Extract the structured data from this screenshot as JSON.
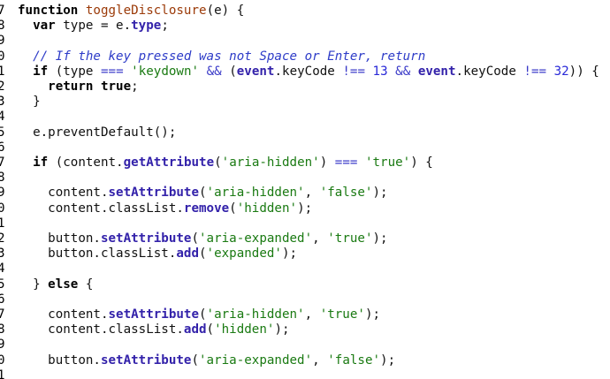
{
  "window": {
    "top_strip_text": ""
  },
  "colors": {
    "background": "#ffffff",
    "keyword": "#000000",
    "function_name": "#9b3a08",
    "property": "#3322aa",
    "string": "#1a7a12",
    "number": "#2a2ad8",
    "comment": "#2e3cc8"
  },
  "lines": [
    {
      "n": "7",
      "tokens": [
        [
          "kw",
          "function"
        ],
        [
          "plain",
          " "
        ],
        [
          "fn",
          "toggleDisclosure"
        ],
        [
          "plain",
          "(e) "
        ],
        [
          "plain",
          "{"
        ]
      ]
    },
    {
      "n": "8",
      "tokens": [
        [
          "plain",
          "  "
        ],
        [
          "kw",
          "var"
        ],
        [
          "plain",
          " type = e."
        ],
        [
          "prop",
          "type"
        ],
        [
          "plain",
          ";"
        ]
      ]
    },
    {
      "n": "9",
      "tokens": []
    },
    {
      "n": "0",
      "tokens": [
        [
          "plain",
          "  "
        ],
        [
          "cmt",
          "// If the key pressed was not Space or Enter, return"
        ]
      ]
    },
    {
      "n": "1",
      "tokens": [
        [
          "plain",
          "  "
        ],
        [
          "kw",
          "if"
        ],
        [
          "plain",
          " (type "
        ],
        [
          "op",
          "==="
        ],
        [
          "plain",
          " "
        ],
        [
          "str",
          "'keydown'"
        ],
        [
          "plain",
          " "
        ],
        [
          "op",
          "&&"
        ],
        [
          "plain",
          " ("
        ],
        [
          "prop",
          "event"
        ],
        [
          "plain",
          ".keyCode "
        ],
        [
          "op",
          "!=="
        ],
        [
          "plain",
          " "
        ],
        [
          "num",
          "13"
        ],
        [
          "plain",
          " "
        ],
        [
          "op",
          "&&"
        ],
        [
          "plain",
          " "
        ],
        [
          "prop",
          "event"
        ],
        [
          "plain",
          ".keyCode "
        ],
        [
          "op",
          "!=="
        ],
        [
          "plain",
          " "
        ],
        [
          "num",
          "32"
        ],
        [
          "plain",
          ")) {"
        ]
      ]
    },
    {
      "n": "2",
      "tokens": [
        [
          "plain",
          "    "
        ],
        [
          "kw",
          "return"
        ],
        [
          "plain",
          " "
        ],
        [
          "kw",
          "true"
        ],
        [
          "plain",
          ";"
        ]
      ]
    },
    {
      "n": "3",
      "tokens": [
        [
          "plain",
          "  }"
        ]
      ]
    },
    {
      "n": "4",
      "tokens": []
    },
    {
      "n": "5",
      "tokens": [
        [
          "plain",
          "  e.preventDefault();"
        ]
      ]
    },
    {
      "n": "6",
      "tokens": []
    },
    {
      "n": "7",
      "tokens": [
        [
          "plain",
          "  "
        ],
        [
          "kw",
          "if"
        ],
        [
          "plain",
          " (content."
        ],
        [
          "prop",
          "getAttribute"
        ],
        [
          "plain",
          "("
        ],
        [
          "str",
          "'aria-hidden'"
        ],
        [
          "plain",
          ") "
        ],
        [
          "op",
          "==="
        ],
        [
          "plain",
          " "
        ],
        [
          "str",
          "'true'"
        ],
        [
          "plain",
          ") {"
        ]
      ]
    },
    {
      "n": "8",
      "tokens": []
    },
    {
      "n": "9",
      "tokens": [
        [
          "plain",
          "    content."
        ],
        [
          "prop",
          "setAttribute"
        ],
        [
          "plain",
          "("
        ],
        [
          "str",
          "'aria-hidden'"
        ],
        [
          "plain",
          ", "
        ],
        [
          "str",
          "'false'"
        ],
        [
          "plain",
          ");"
        ]
      ]
    },
    {
      "n": "0",
      "tokens": [
        [
          "plain",
          "    content.classList."
        ],
        [
          "prop",
          "remove"
        ],
        [
          "plain",
          "("
        ],
        [
          "str",
          "'hidden'"
        ],
        [
          "plain",
          ");"
        ]
      ]
    },
    {
      "n": "1",
      "tokens": []
    },
    {
      "n": "2",
      "tokens": [
        [
          "plain",
          "    button."
        ],
        [
          "prop",
          "setAttribute"
        ],
        [
          "plain",
          "("
        ],
        [
          "str",
          "'aria-expanded'"
        ],
        [
          "plain",
          ", "
        ],
        [
          "str",
          "'true'"
        ],
        [
          "plain",
          ");"
        ]
      ]
    },
    {
      "n": "3",
      "tokens": [
        [
          "plain",
          "    button.classList."
        ],
        [
          "prop",
          "add"
        ],
        [
          "plain",
          "("
        ],
        [
          "str",
          "'expanded'"
        ],
        [
          "plain",
          ");"
        ]
      ]
    },
    {
      "n": "4",
      "tokens": []
    },
    {
      "n": "5",
      "tokens": [
        [
          "plain",
          "  } "
        ],
        [
          "kw",
          "else"
        ],
        [
          "plain",
          " {"
        ]
      ]
    },
    {
      "n": "6",
      "tokens": []
    },
    {
      "n": "7",
      "tokens": [
        [
          "plain",
          "    content."
        ],
        [
          "prop",
          "setAttribute"
        ],
        [
          "plain",
          "("
        ],
        [
          "str",
          "'aria-hidden'"
        ],
        [
          "plain",
          ", "
        ],
        [
          "str",
          "'true'"
        ],
        [
          "plain",
          ");"
        ]
      ]
    },
    {
      "n": "8",
      "tokens": [
        [
          "plain",
          "    content.classList."
        ],
        [
          "prop",
          "add"
        ],
        [
          "plain",
          "("
        ],
        [
          "str",
          "'hidden'"
        ],
        [
          "plain",
          ");"
        ]
      ]
    },
    {
      "n": "9",
      "tokens": []
    },
    {
      "n": "0",
      "tokens": [
        [
          "plain",
          "    button."
        ],
        [
          "prop",
          "setAttribute"
        ],
        [
          "plain",
          "("
        ],
        [
          "str",
          "'aria-expanded'"
        ],
        [
          "plain",
          ", "
        ],
        [
          "str",
          "'false'"
        ],
        [
          "plain",
          ");"
        ]
      ]
    },
    {
      "n": "1",
      "tokens": []
    }
  ]
}
